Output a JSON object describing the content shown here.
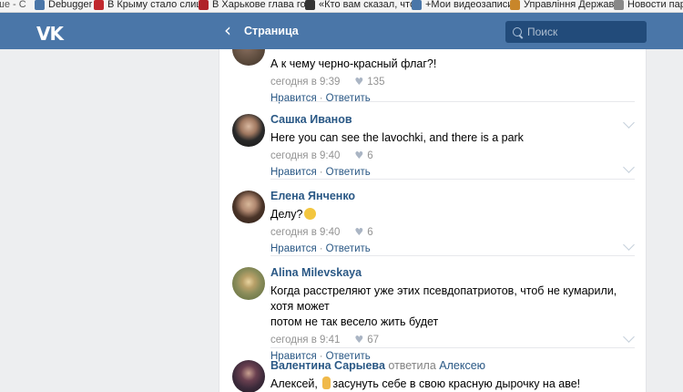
{
  "bookmarks": [
    {
      "label": "Debugger",
      "color": "#4a76a8"
    },
    {
      "label": "В Крыму стало слиш",
      "color": "#c0282d"
    },
    {
      "label": "В Харькове глава гос",
      "color": "#b0232a"
    },
    {
      "label": "«Кто вам сказал, что",
      "color": "#333333"
    },
    {
      "label": "+Мои видеозаписи",
      "color": "#4a76a8"
    },
    {
      "label": "Управління Державн",
      "color": "#c8862a"
    },
    {
      "label": "Новости парт",
      "color": "#666666"
    }
  ],
  "header": {
    "logo": "VK",
    "back": "‹",
    "title": "Страница",
    "search_placeholder": "Поиск"
  },
  "comments": [
    {
      "author": "",
      "text": "А к чему черно-красный флаг?!",
      "time": "сегодня в 9:39",
      "likes": "135",
      "like_label": "Нравится",
      "reply_label": "Ответить",
      "avatar_color": "#5b4a3c"
    },
    {
      "author": "Сашка Иванов",
      "text": "Here you can see the lavochki, and there is a park",
      "time": "сегодня в 9:40",
      "likes": "6",
      "like_label": "Нравится",
      "reply_label": "Ответить",
      "avatar_color": "#3a3a3a"
    },
    {
      "author": "Елена Янченко",
      "text": "Делу?",
      "time": "сегодня в 9:40",
      "likes": "6",
      "like_label": "Нравится",
      "reply_label": "Ответить",
      "avatar_color": "#4a3428"
    },
    {
      "author": "Alina Milevskaya",
      "text_line1": "Когда расстреляют уже этих псевдопатриотов, чтоб не кумарили, хотя может",
      "text_line2": "потом не так весело жить будет",
      "time": "сегодня в 9:41",
      "likes": "67",
      "like_label": "Нравится",
      "reply_label": "Ответить",
      "avatar_color": "#8a8c5a"
    },
    {
      "author": "Валентина Сарыева",
      "reply_word": "ответила",
      "reply_target": "Алексею",
      "text_before": "Алексей,",
      "text_after": "засунуть себе в свою красную дырочку на аве!",
      "avatar_color": "#3b2a3a"
    }
  ]
}
